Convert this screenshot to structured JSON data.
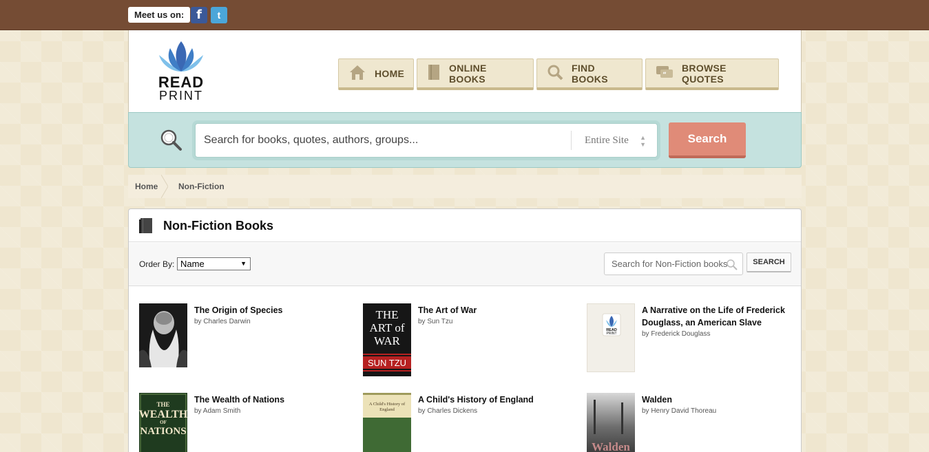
{
  "topbar": {
    "meet_label": "Meet us on:",
    "facebook_glyph": "f",
    "twitter_glyph": "t"
  },
  "logo": {
    "word1": "READ",
    "word2": "PRINT"
  },
  "nav": [
    {
      "label": "HOME",
      "icon": "home-icon"
    },
    {
      "label": "ONLINE BOOKS",
      "icon": "book-icon"
    },
    {
      "label": "FIND BOOKS",
      "icon": "search-icon"
    },
    {
      "label": "BROWSE QUOTES",
      "icon": "quote-icon"
    }
  ],
  "search": {
    "placeholder": "Search for books, quotes, authors, groups...",
    "scope": "Entire Site",
    "button": "Search"
  },
  "breadcrumb": {
    "home": "Home",
    "current": "Non-Fiction"
  },
  "panel": {
    "title": "Non-Fiction Books",
    "order_label": "Order By:",
    "order_value": "Name",
    "local_search_placeholder": "Search for Non-Fiction books",
    "local_search_button": "SEARCH"
  },
  "books": [
    {
      "title": "The Origin of Species",
      "author": "by Charles Darwin"
    },
    {
      "title": "The Art of War",
      "author": "by Sun Tzu",
      "cover_text": [
        "THE",
        "ART of",
        "WAR",
        "SUN TZU"
      ]
    },
    {
      "title": "A Narrative on the Life of Frederick Douglass, an American Slave",
      "author": "by Frederick Douglass",
      "cover_text": [
        "READ",
        "PRINT"
      ]
    },
    {
      "title": "The Wealth of Nations",
      "author": "by Adam Smith",
      "cover_text": [
        "THE",
        "WEALTH",
        "OF",
        "NATIONS"
      ]
    },
    {
      "title": "A Child's History of England",
      "author": "by Charles Dickens",
      "cover_text": [
        "A Child's History of",
        "England"
      ]
    },
    {
      "title": "Walden",
      "author": "by Henry David Thoreau",
      "cover_text": [
        "Walden"
      ]
    }
  ],
  "colors": {
    "topbar": "#754c34",
    "search_area": "#c5e2df",
    "search_button": "#e08b78",
    "nav_bg": "#efe7cf"
  }
}
